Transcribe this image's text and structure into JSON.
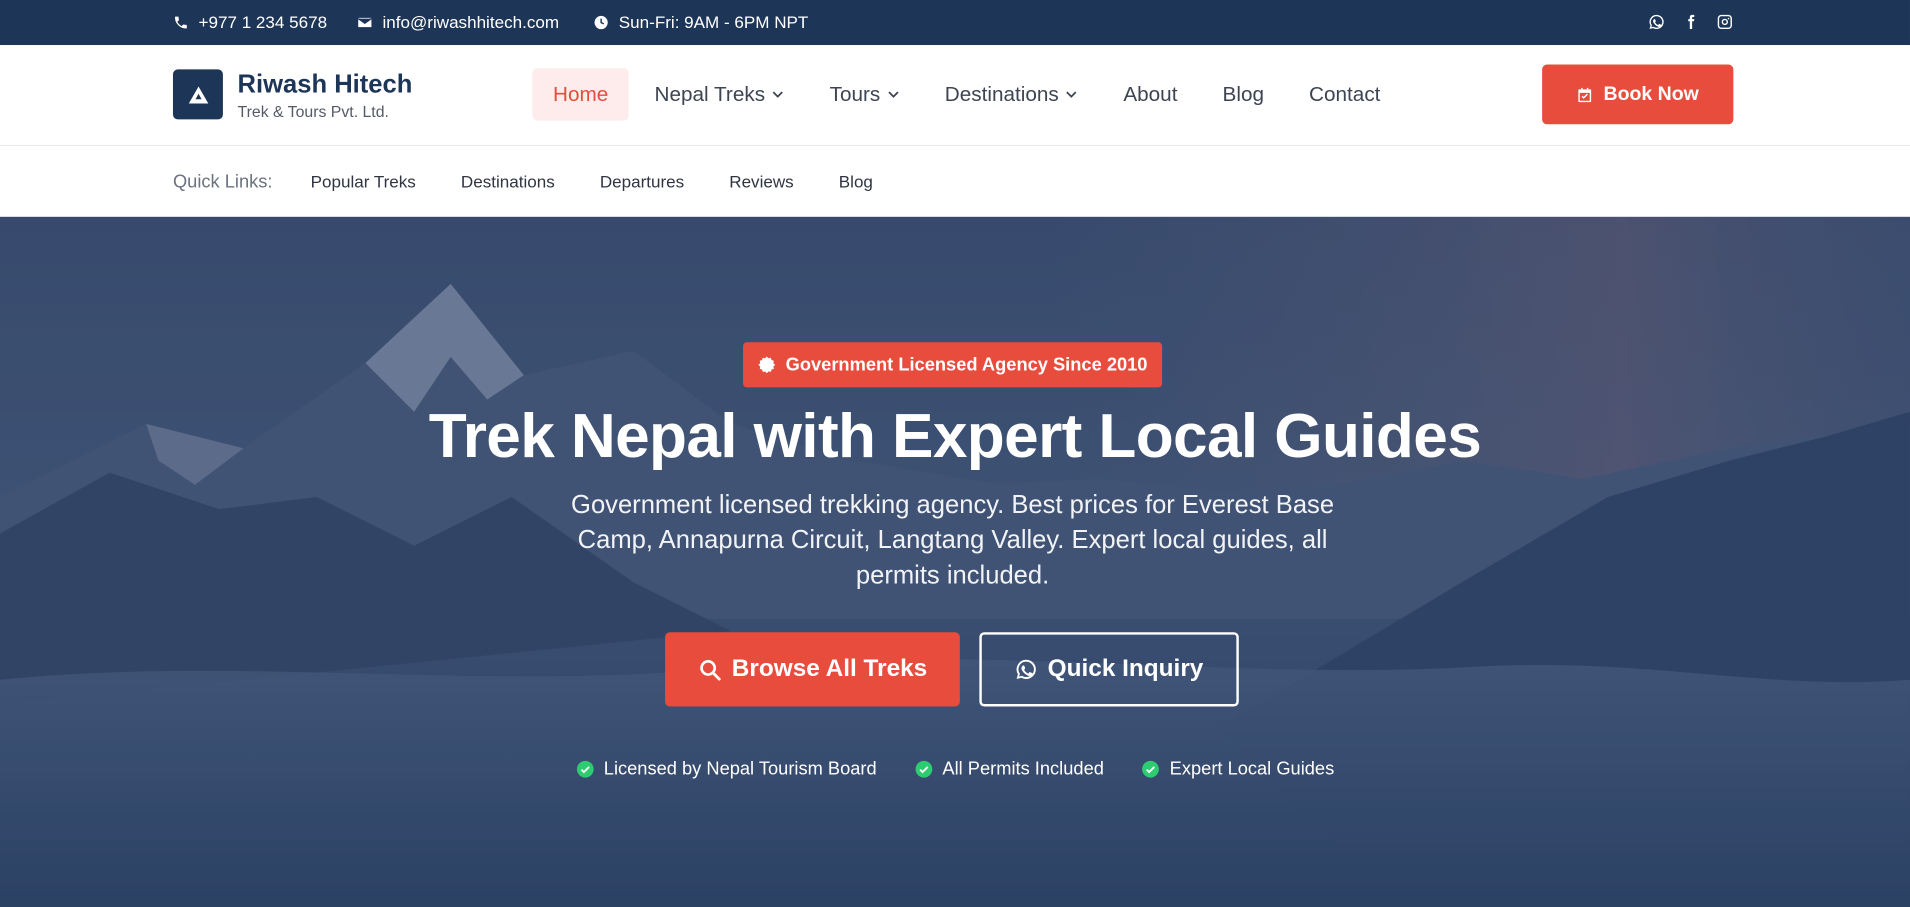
{
  "topbar": {
    "phone": "+977 1 234 5678",
    "email": "info@riwashhitech.com",
    "hours": "Sun-Fri: 9AM - 6PM NPT",
    "social": [
      "whatsapp-icon",
      "facebook-icon",
      "instagram-icon"
    ]
  },
  "brand": {
    "name": "Riwash Hitech",
    "tagline": "Trek & Tours Pvt. Ltd."
  },
  "nav": {
    "items": [
      {
        "label": "Home",
        "active": true
      },
      {
        "label": "Nepal Treks",
        "dropdown": true
      },
      {
        "label": "Tours",
        "dropdown": true
      },
      {
        "label": "Destinations",
        "dropdown": true
      },
      {
        "label": "About"
      },
      {
        "label": "Blog"
      },
      {
        "label": "Contact"
      }
    ],
    "cta": "Book Now"
  },
  "quick_links": {
    "label": "Quick Links:",
    "items": [
      "Popular Treks",
      "Destinations",
      "Departures",
      "Reviews",
      "Blog"
    ]
  },
  "hero": {
    "badge": "Government Licensed Agency Since 2010",
    "title": "Trek Nepal with Expert Local Guides",
    "subtitle": "Government licensed trekking agency. Best prices for Everest Base Camp, Annapurna Circuit, Langtang Valley. Expert local guides, all permits included.",
    "primary_button": "Browse All Treks",
    "secondary_button": "Quick Inquiry",
    "trust": [
      "Licensed by Nepal Tourism Board",
      "All Permits Included",
      "Expert Local Guides"
    ]
  },
  "colors": {
    "navy": "#1d3557",
    "accent": "#e74c3c",
    "check": "#2ecc71"
  }
}
